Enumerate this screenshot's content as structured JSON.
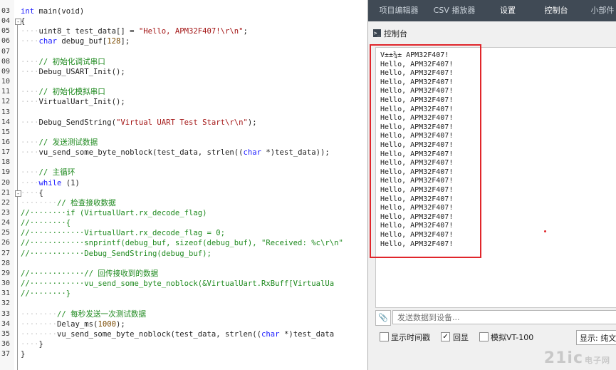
{
  "editor": {
    "lines": [
      {
        "n": "03",
        "fold": "",
        "segs": [
          {
            "t": "int",
            "c": "kw"
          },
          {
            "t": " main(void)"
          }
        ]
      },
      {
        "n": "04",
        "fold": "-",
        "segs": [
          {
            "t": "{"
          }
        ]
      },
      {
        "n": "05",
        "fold": "",
        "segs": [
          {
            "t": "····",
            "c": "ws"
          },
          {
            "t": "uint8_t test_data[] = "
          },
          {
            "t": "\"Hello, APM32F407!\\r\\n\"",
            "c": "st"
          },
          {
            "t": ";"
          }
        ]
      },
      {
        "n": "06",
        "fold": "",
        "segs": [
          {
            "t": "····",
            "c": "ws"
          },
          {
            "t": "char",
            "c": "kw"
          },
          {
            "t": " debug_buf["
          },
          {
            "t": "128",
            "c": "nm"
          },
          {
            "t": "];"
          }
        ]
      },
      {
        "n": "07",
        "fold": "",
        "segs": []
      },
      {
        "n": "08",
        "fold": "",
        "segs": [
          {
            "t": "····",
            "c": "ws"
          },
          {
            "t": "// 初始化调试串口",
            "c": "cm"
          }
        ]
      },
      {
        "n": "09",
        "fold": "",
        "segs": [
          {
            "t": "····",
            "c": "ws"
          },
          {
            "t": "Debug_USART_Init();"
          }
        ]
      },
      {
        "n": "10",
        "fold": "",
        "segs": []
      },
      {
        "n": "11",
        "fold": "",
        "segs": [
          {
            "t": "····",
            "c": "ws"
          },
          {
            "t": "// 初始化模拟串口",
            "c": "cm"
          }
        ]
      },
      {
        "n": "12",
        "fold": "",
        "segs": [
          {
            "t": "····",
            "c": "ws"
          },
          {
            "t": "VirtualUart_Init();"
          }
        ]
      },
      {
        "n": "13",
        "fold": "",
        "segs": []
      },
      {
        "n": "14",
        "fold": "",
        "segs": [
          {
            "t": "····",
            "c": "ws"
          },
          {
            "t": "Debug_SendString("
          },
          {
            "t": "\"Virtual UART Test Start\\r\\n\"",
            "c": "st"
          },
          {
            "t": ");"
          }
        ]
      },
      {
        "n": "15",
        "fold": "",
        "segs": []
      },
      {
        "n": "16",
        "fold": "",
        "segs": [
          {
            "t": "····",
            "c": "ws"
          },
          {
            "t": "// 发送测试数据",
            "c": "cm"
          }
        ]
      },
      {
        "n": "17",
        "fold": "",
        "segs": [
          {
            "t": "····",
            "c": "ws"
          },
          {
            "t": "vu_send_some_byte_noblock(test_data, strlen(("
          },
          {
            "t": "char",
            "c": "kw"
          },
          {
            "t": " *)test_data));"
          }
        ]
      },
      {
        "n": "18",
        "fold": "",
        "segs": []
      },
      {
        "n": "19",
        "fold": "",
        "segs": [
          {
            "t": "····",
            "c": "ws"
          },
          {
            "t": "// 主循环",
            "c": "cm"
          }
        ]
      },
      {
        "n": "20",
        "fold": "",
        "segs": [
          {
            "t": "····",
            "c": "ws"
          },
          {
            "t": "while",
            "c": "kw"
          },
          {
            "t": " (1)"
          }
        ]
      },
      {
        "n": "21",
        "fold": "-",
        "segs": [
          {
            "t": "····",
            "c": "ws"
          },
          {
            "t": "{"
          }
        ]
      },
      {
        "n": "22",
        "fold": "",
        "segs": [
          {
            "t": "········",
            "c": "ws"
          },
          {
            "t": "// 检查接收数据",
            "c": "cm"
          }
        ]
      },
      {
        "n": "23",
        "fold": "",
        "segs": [
          {
            "t": "//········",
            "c": "cm"
          },
          {
            "t": "if (VirtualUart.rx_decode_flag)",
            "c": "cm"
          }
        ]
      },
      {
        "n": "24",
        "fold": "",
        "segs": [
          {
            "t": "//········{",
            "c": "cm"
          }
        ]
      },
      {
        "n": "25",
        "fold": "",
        "segs": [
          {
            "t": "//············",
            "c": "cm"
          },
          {
            "t": "VirtualUart.rx_decode_flag = 0;",
            "c": "cm"
          }
        ]
      },
      {
        "n": "26",
        "fold": "",
        "segs": [
          {
            "t": "//············",
            "c": "cm"
          },
          {
            "t": "snprintf(debug_buf, sizeof(debug_buf), \"Received: %c\\r\\n\"",
            "c": "cm"
          }
        ]
      },
      {
        "n": "27",
        "fold": "",
        "segs": [
          {
            "t": "//············",
            "c": "cm"
          },
          {
            "t": "Debug_SendString(debug_buf);",
            "c": "cm"
          }
        ]
      },
      {
        "n": "28",
        "fold": "",
        "segs": []
      },
      {
        "n": "29",
        "fold": "",
        "segs": [
          {
            "t": "//············",
            "c": "cm"
          },
          {
            "t": "// 回传接收到的数据",
            "c": "cm"
          }
        ]
      },
      {
        "n": "30",
        "fold": "",
        "segs": [
          {
            "t": "//············",
            "c": "cm"
          },
          {
            "t": "vu_send_some_byte_noblock(&VirtualUart.RxBuff[VirtualUa",
            "c": "cm"
          }
        ]
      },
      {
        "n": "31",
        "fold": "",
        "segs": [
          {
            "t": "//········}",
            "c": "cm"
          }
        ]
      },
      {
        "n": "32",
        "fold": "",
        "segs": []
      },
      {
        "n": "33",
        "fold": "",
        "segs": [
          {
            "t": "········",
            "c": "ws"
          },
          {
            "t": "// 每秒发送一次测试数据",
            "c": "cm"
          }
        ]
      },
      {
        "n": "34",
        "fold": "",
        "segs": [
          {
            "t": "········",
            "c": "ws"
          },
          {
            "t": "Delay_ms("
          },
          {
            "t": "1000",
            "c": "nm"
          },
          {
            "t": ");"
          }
        ]
      },
      {
        "n": "35",
        "fold": "",
        "segs": [
          {
            "t": "········",
            "c": "ws"
          },
          {
            "t": "vu_send_some_byte_noblock(test_data, strlen(("
          },
          {
            "t": "char",
            "c": "kw"
          },
          {
            "t": " *)test_data"
          }
        ]
      },
      {
        "n": "36",
        "fold": "",
        "segs": [
          {
            "t": "····",
            "c": "ws"
          },
          {
            "t": "}"
          }
        ]
      },
      {
        "n": "37",
        "fold": "",
        "segs": [
          {
            "t": "}"
          }
        ]
      }
    ]
  },
  "panel": {
    "tabs": [
      {
        "label": "项目编辑器",
        "active": false
      },
      {
        "label": "CSV 播放器",
        "active": false
      },
      {
        "label": "设置",
        "active": true
      },
      {
        "label": "控制台",
        "active": true
      },
      {
        "label": "小部件",
        "active": false
      }
    ],
    "title": "控制台",
    "terminal_icon": ">_",
    "output_lines": [
      "V±±¾± APM32F407!",
      "Hello, APM32F407!",
      "Hello, APM32F407!",
      "Hello, APM32F407!",
      "Hello, APM32F407!",
      "Hello, APM32F407!",
      "Hello, APM32F407!",
      "Hello, APM32F407!",
      "Hello, APM32F407!",
      "Hello, APM32F407!",
      "Hello, APM32F407!",
      "Hello, APM32F407!",
      "Hello, APM32F407!",
      "Hello, APM32F407!",
      "Hello, APM32F407!",
      "Hello, APM32F407!",
      "Hello, APM32F407!",
      "Hello, APM32F407!",
      "Hello, APM32F407!",
      "Hello, APM32F407!",
      "Hello, APM32F407!",
      "Hello, APM32F407!"
    ],
    "send_placeholder": "发送数据到设备...",
    "attach_icon": "📎",
    "options": {
      "show_timestamp": {
        "label": "显示时间戳",
        "checked": false
      },
      "echo": {
        "label": "回显",
        "checked": true
      },
      "vt100": {
        "label": "模拟VT-100",
        "checked": false
      }
    },
    "display_mode": "显示: 纯文"
  },
  "watermark": {
    "main": "21ic",
    "sub": "电子网"
  },
  "colors": {
    "tab_bar": "#404a55",
    "highlight_frame": "#e0262b",
    "comment": "#1f8a1f",
    "keyword": "#1c1cff",
    "string": "#a31515"
  }
}
